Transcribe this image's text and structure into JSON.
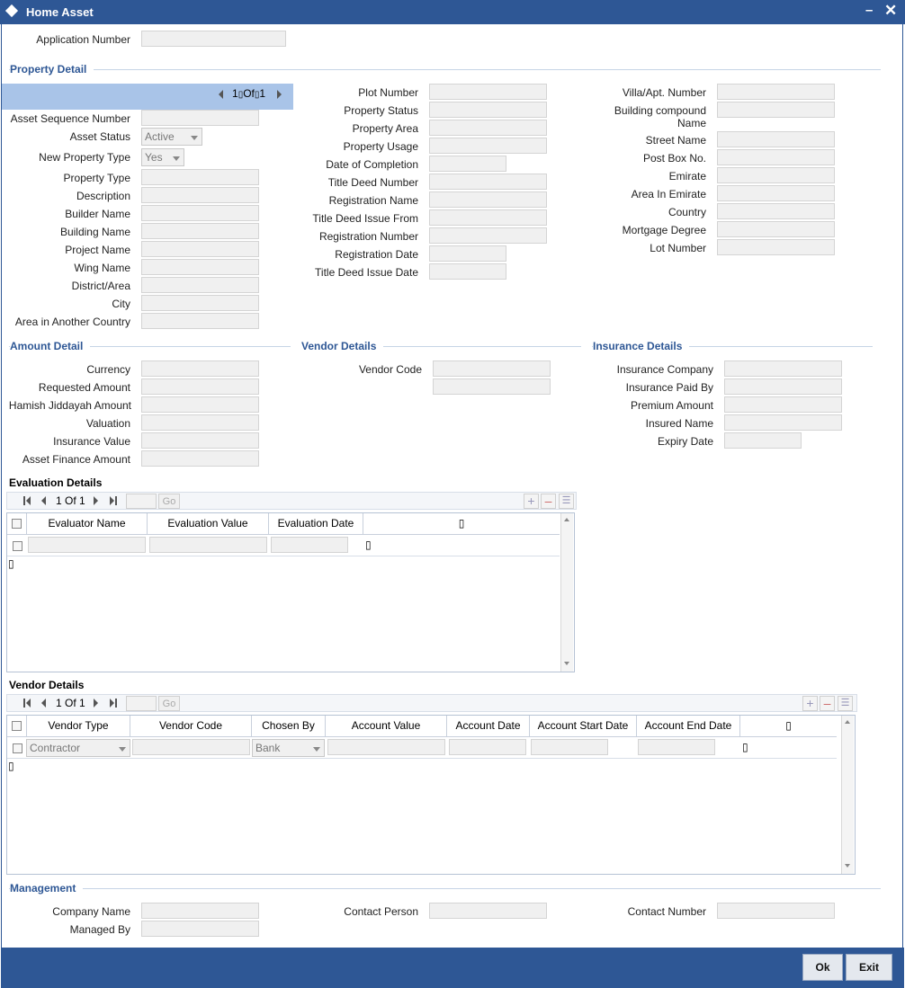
{
  "window": {
    "title": "Home Asset"
  },
  "app": {
    "application_number_label": "Application Number"
  },
  "property_detail": {
    "section_title": "Property Detail",
    "pager": {
      "current": "1",
      "of": "Of",
      "total": "1"
    },
    "col1": {
      "asset_sequence_number": "Asset Sequence Number",
      "asset_status": "Asset Status",
      "asset_status_value": "Active",
      "new_property_type": "New Property Type",
      "new_property_type_value": "Yes",
      "property_type": "Property Type",
      "description": "Description",
      "builder_name": "Builder Name",
      "building_name": "Building Name",
      "project_name": "Project Name",
      "wing_name": "Wing Name",
      "district_area": "District/Area",
      "city": "City",
      "area_in_another_country": "Area in Another Country"
    },
    "col2": {
      "plot_number": "Plot Number",
      "property_status": "Property Status",
      "property_area": "Property Area",
      "property_usage": "Property Usage",
      "date_of_completion": "Date of Completion",
      "title_deed_number": "Title Deed Number",
      "registration_name": "Registration Name",
      "title_deed_issue_from": "Title Deed Issue From",
      "registration_number": "Registration Number",
      "registration_date": "Registration Date",
      "title_deed_issue_date": "Title Deed Issue Date"
    },
    "col3": {
      "villa_apt_number": "Villa/Apt. Number",
      "building_compound_name": "Building compound Name",
      "street_name": "Street Name",
      "post_box_no": "Post Box No.",
      "emirate": "Emirate",
      "area_in_emirate": "Area In Emirate",
      "country": "Country",
      "mortgage_degree": "Mortgage Degree",
      "lot_number": "Lot Number"
    }
  },
  "amount_detail": {
    "section_title": "Amount Detail",
    "currency": "Currency",
    "requested_amount": "Requested Amount",
    "hamish_jiddayah_amount": "Hamish Jiddayah Amount",
    "valuation": "Valuation",
    "insurance_value": "Insurance Value",
    "asset_finance_amount": "Asset Finance Amount"
  },
  "vendor_details_section": {
    "section_title": "Vendor Details",
    "vendor_code": "Vendor Code"
  },
  "insurance_details": {
    "section_title": "Insurance Details",
    "insurance_company": "Insurance Company",
    "insurance_paid_by": "Insurance Paid By",
    "premium_amount": "Premium Amount",
    "insured_name": "Insured Name",
    "expiry_date": "Expiry Date"
  },
  "evaluation_grid": {
    "title": "Evaluation Details",
    "pager_text": "1 Of 1",
    "go": "Go",
    "columns": [
      "Evaluator Name",
      "Evaluation Value",
      "Evaluation Date"
    ],
    "glyph": "▯"
  },
  "vendor_grid": {
    "title": "Vendor Details",
    "pager_text": "1 Of 1",
    "go": "Go",
    "columns": [
      "Vendor Type",
      "Vendor Code",
      "Chosen By",
      "Account Value",
      "Account Date",
      "Account Start Date",
      "Account End Date"
    ],
    "row": {
      "vendor_type": "Contractor",
      "chosen_by": "Bank"
    },
    "glyph": "▯"
  },
  "management": {
    "section_title": "Management",
    "company_name": "Company Name",
    "managed_by": "Managed By",
    "contact_person": "Contact Person",
    "contact_number": "Contact Number"
  },
  "footer": {
    "ok": "Ok",
    "exit": "Exit"
  }
}
